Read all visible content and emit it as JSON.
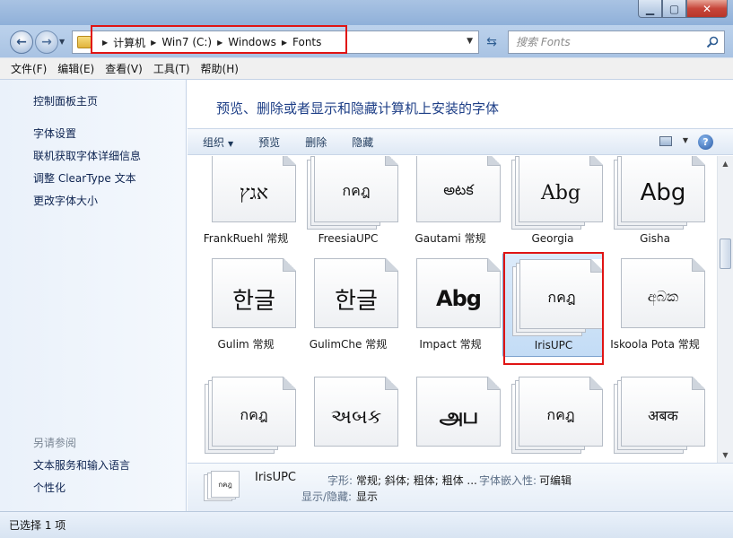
{
  "address": {
    "crumbs": [
      "计算机",
      "Win7 (C:)",
      "Windows",
      "Fonts"
    ],
    "search_placeholder": "搜索 Fonts"
  },
  "menu": [
    "文件(F)",
    "编辑(E)",
    "查看(V)",
    "工具(T)",
    "帮助(H)"
  ],
  "left_pane": {
    "home": "控制面板主页",
    "links": [
      "字体设置",
      "联机获取字体详细信息",
      "调整 ClearType 文本",
      "更改字体大小"
    ],
    "see_also_title": "另请参阅",
    "see_also": [
      "文本服务和输入语言",
      "个性化"
    ]
  },
  "header_title": "预览、删除或者显示和隐藏计算机上安装的字体",
  "toolbar": {
    "organize": "组织",
    "preview": "预览",
    "delete": "删除",
    "hide": "隐藏",
    "help": "?"
  },
  "fonts": [
    {
      "sample": "אגץ",
      "label": "FrankRuehl 常规",
      "stack": false
    },
    {
      "sample": "กคฎ",
      "label": "FreesiaUPC",
      "stack": true
    },
    {
      "sample": "అటక",
      "label": "Gautami 常规",
      "stack": false
    },
    {
      "sample": "Abg",
      "label": "Georgia",
      "stack": true
    },
    {
      "sample": "Abg",
      "label": "Gisha",
      "stack": true
    },
    {
      "sample": "한글",
      "label": "Gulim 常规",
      "stack": false
    },
    {
      "sample": "한글",
      "label": "GulimChe 常规",
      "stack": false
    },
    {
      "sample": "Abg",
      "label": "Impact 常规",
      "stack": false
    },
    {
      "sample": "กคฎ",
      "label": "IrisUPC",
      "stack": true,
      "selected": true
    },
    {
      "sample": "අබක",
      "label": "Iskoola Pota 常规",
      "stack": false
    },
    {
      "sample": "กคฎ",
      "label": "",
      "stack": true
    },
    {
      "sample": "અબક",
      "label": "",
      "stack": false
    },
    {
      "sample": "அப",
      "label": "",
      "stack": false
    },
    {
      "sample": "กคฎ",
      "label": "",
      "stack": true
    },
    {
      "sample": "अबक",
      "label": "",
      "stack": true
    }
  ],
  "details": {
    "name": "IrisUPC",
    "style_key": "字形:",
    "style_val": "常规; 斜体; 粗体; 粗体 ...",
    "embed_key": "字体嵌入性:",
    "embed_val": "可编辑",
    "showhide_key": "显示/隐藏:",
    "showhide_val": "显示",
    "thumb_sample": "กคฎ"
  },
  "status": "已选择 1 项",
  "colors": {
    "accent_title": "#1e3f87",
    "selection": "#c3dcf5",
    "highlight_red": "#e01414"
  }
}
